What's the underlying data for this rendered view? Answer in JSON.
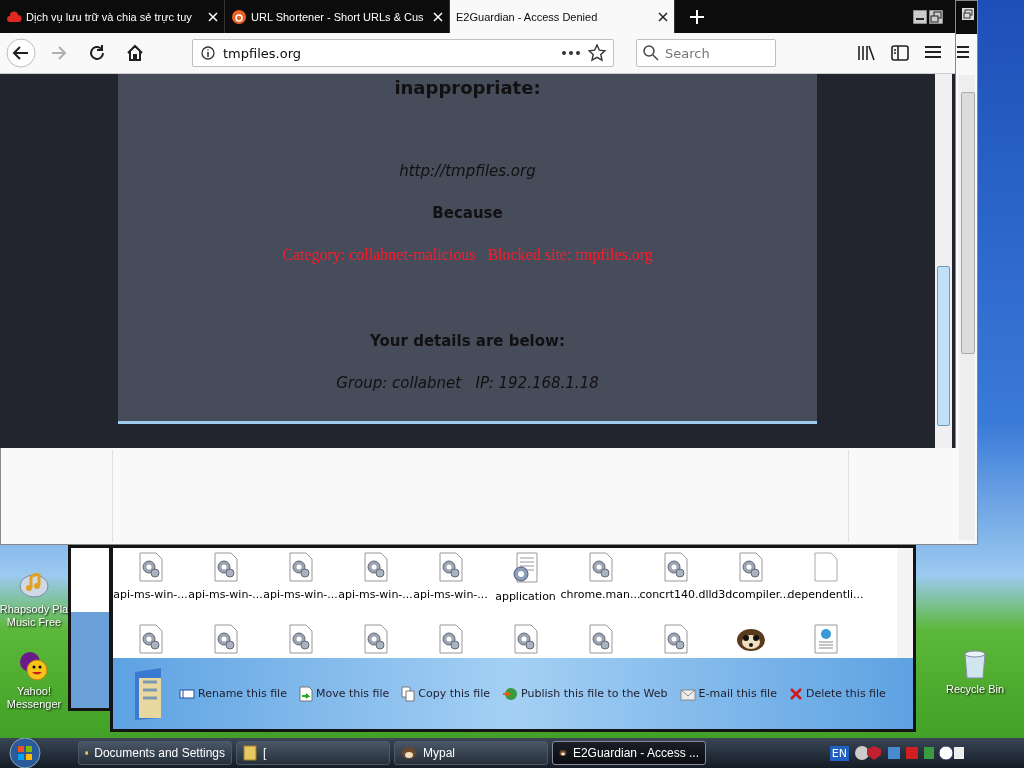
{
  "browser": {
    "tabs": [
      {
        "title": "Dịch vụ lưu trữ và chia sẻ trực tuy",
        "selected": false
      },
      {
        "title": "URL Shortener - Short URLs & Cus",
        "selected": false
      },
      {
        "title": "E2Guardian - Access Denied",
        "selected": true
      }
    ],
    "nav_buttons": [
      {
        "kind": "back",
        "disabled": false
      },
      {
        "kind": "forward",
        "disabled": true
      },
      {
        "kind": "reload",
        "disabled": false
      },
      {
        "kind": "home",
        "disabled": false
      }
    ],
    "address_bar": {
      "value": "tmpfiles.org"
    },
    "search_field": {
      "placeholder": "Search"
    },
    "page": {
      "heading": "inappropriate:",
      "url": "http://tmpfiles.org",
      "because": "Because",
      "reason": "Category: collabnet-malicious   Blocked site: tmpfiles.org",
      "details_heading": "Your details are below:",
      "details": "Group: collabnet   IP: 192.168.1.18"
    }
  },
  "explorer": {
    "files": [
      {
        "name": "api-ms-win-...",
        "kind": "dll"
      },
      {
        "name": "api-ms-win-...",
        "kind": "dll"
      },
      {
        "name": "api-ms-win-...",
        "kind": "dll"
      },
      {
        "name": "api-ms-win-...",
        "kind": "dll"
      },
      {
        "name": "api-ms-win-...",
        "kind": "dll"
      },
      {
        "name": "application",
        "kind": "app"
      },
      {
        "name": "chrome.man...",
        "kind": "dll"
      },
      {
        "name": "concrt140.dll",
        "kind": "dll"
      },
      {
        "name": "d3dcompiler...",
        "kind": "dll"
      },
      {
        "name": "dependentli...",
        "kind": "blank"
      }
    ],
    "files_row2": [
      {
        "kind": "dll"
      },
      {
        "kind": "dll"
      },
      {
        "kind": "dll"
      },
      {
        "kind": "dll"
      },
      {
        "kind": "dll"
      },
      {
        "kind": "dll"
      },
      {
        "kind": "dll"
      },
      {
        "kind": "dll"
      },
      {
        "kind": "raccoon"
      },
      {
        "kind": "web"
      }
    ],
    "tasks": [
      {
        "label": "Rename this file",
        "kind": "rename"
      },
      {
        "label": "Move this file",
        "kind": "move"
      },
      {
        "label": "Copy this file",
        "kind": "copy"
      },
      {
        "label": "Publish this file to the Web",
        "kind": "publish"
      },
      {
        "label": "E-mail this file",
        "kind": "email"
      },
      {
        "label": "Delete this file",
        "kind": "delete"
      }
    ]
  },
  "desktop_icons": [
    {
      "lines": [
        "Rhapsody Pla",
        "Music Free"
      ],
      "kind": "music"
    },
    {
      "lines": [
        "Yahoo!",
        "Messenger"
      ],
      "kind": "yahoo"
    },
    {
      "lines": [
        "Recycle Bin"
      ],
      "kind": "bin"
    }
  ],
  "taskbar": {
    "buttons": [
      {
        "label": "Documents and Settings",
        "selected": false
      },
      {
        "label": "[",
        "selected": false
      },
      {
        "label": "Mypal",
        "selected": false
      },
      {
        "label": "E2Guardian - Access ...",
        "selected": true
      }
    ],
    "language": "EN"
  }
}
